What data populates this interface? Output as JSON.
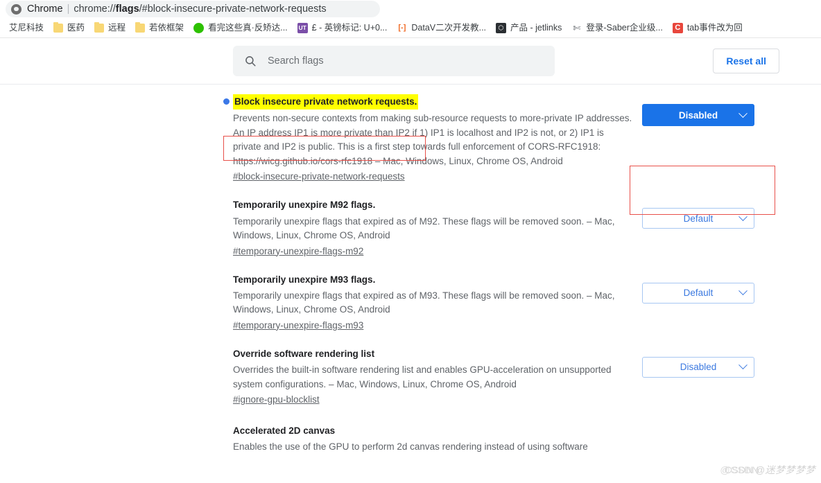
{
  "browser": {
    "omnibox": {
      "brand": "Chrome",
      "separator": "|",
      "url_prefix": "chrome://",
      "url_bold": "flags",
      "url_suffix": "/#block-insecure-private-network-requests",
      "chrome_icon": "chrome-logo-icon"
    },
    "bookmarks": [
      {
        "label": "艾尼科技",
        "icon": "none"
      },
      {
        "label": "医药",
        "icon": "folder-icon",
        "glyph": ""
      },
      {
        "label": "远程",
        "icon": "folder-icon",
        "glyph": ""
      },
      {
        "label": "若依框架",
        "icon": "folder-icon",
        "glyph": ""
      },
      {
        "label": "看完这些真·反矫达...",
        "icon": "wechat-icon",
        "glyph": ""
      },
      {
        "label": "£ - 英镑标记: U+0...",
        "icon": "ut-icon",
        "glyph": "UT"
      },
      {
        "label": "DataV二次开发教...",
        "icon": "bracket-icon",
        "glyph": "[-]"
      },
      {
        "label": "产品 - jetlinks",
        "icon": "jetlinks-icon",
        "glyph": "⬡"
      },
      {
        "label": "登录-Saber企业级...",
        "icon": "sword-icon",
        "glyph": "✄"
      },
      {
        "label": "tab事件改为回",
        "icon": "csdn-icon",
        "glyph": "C"
      }
    ]
  },
  "search": {
    "placeholder": "Search flags",
    "value": "",
    "icon": "search-icon"
  },
  "toolbar": {
    "reset_all_label": "Reset all"
  },
  "flags": [
    {
      "title": "Block insecure private network requests.",
      "highlighted": true,
      "has_dot": true,
      "description": "Prevents non-secure contexts from making sub-resource requests to more-private IP addresses. An IP address IP1 is more private than IP2 if 1) IP1 is localhost and IP2 is not, or 2) IP1 is private and IP2 is public. This is a first step towards full enforcement of CORS-RFC1918: https://wicg.github.io/cors-rfc1918 – Mac, Windows, Linux, Chrome OS, Android",
      "permalink": "#block-insecure-private-network-requests",
      "select_value": "Disabled",
      "select_active": true
    },
    {
      "title": "Temporarily unexpire M92 flags.",
      "highlighted": false,
      "has_dot": false,
      "description": "Temporarily unexpire flags that expired as of M92. These flags will be removed soon. – Mac, Windows, Linux, Chrome OS, Android",
      "permalink": "#temporary-unexpire-flags-m92",
      "select_value": "Default",
      "select_active": false
    },
    {
      "title": "Temporarily unexpire M93 flags.",
      "highlighted": false,
      "has_dot": false,
      "description": "Temporarily unexpire flags that expired as of M93. These flags will be removed soon. – Mac, Windows, Linux, Chrome OS, Android",
      "permalink": "#temporary-unexpire-flags-m93",
      "select_value": "Default",
      "select_active": false
    },
    {
      "title": "Override software rendering list",
      "highlighted": false,
      "has_dot": false,
      "description": "Overrides the built-in software rendering list and enables GPU-acceleration on unsupported system configurations. – Mac, Windows, Linux, Chrome OS, Android",
      "permalink": "#ignore-gpu-blocklist",
      "select_value": "Disabled",
      "select_active": false
    },
    {
      "title": "Accelerated 2D canvas",
      "highlighted": false,
      "has_dot": false,
      "description": "Enables the use of the GPU to perform 2d canvas rendering instead of using software",
      "permalink": "",
      "select_value": "",
      "select_active": false
    }
  ],
  "annotations": {
    "title_box_color": "#e8504a",
    "select_box_color": "#e8504a",
    "highlight_color": "#ffff00",
    "accent_color": "#1a73e8"
  },
  "watermark": {
    "part1": "CSDN",
    "part2": "@CSDN",
    "part3": "@迷梦梦梦梦"
  }
}
